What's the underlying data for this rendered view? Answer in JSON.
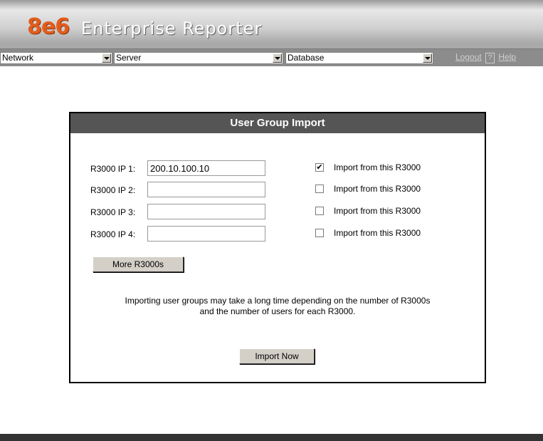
{
  "logo": {
    "number": "8e6",
    "product": "Enterprise Reporter"
  },
  "nav": {
    "network": "Network",
    "server": "Server",
    "database": "Database",
    "logout": "Logout",
    "help_icon": "?",
    "help": "Help"
  },
  "panel": {
    "title": "User Group Import",
    "rows": [
      {
        "label": "R3000 IP 1:",
        "value": "200.10.100.10",
        "checked": true,
        "check_label": "Import from this R3000"
      },
      {
        "label": "R3000 IP 2:",
        "value": "",
        "checked": false,
        "check_label": "Import from this R3000"
      },
      {
        "label": "R3000 IP 3:",
        "value": "",
        "checked": false,
        "check_label": "Import from this R3000"
      },
      {
        "label": "R3000 IP 4:",
        "value": "",
        "checked": false,
        "check_label": "Import from this R3000"
      }
    ],
    "more_button": "More R3000s",
    "info_line1": "Importing user groups may take a long time depending on the number of R3000s",
    "info_line2": "and the number of users for each R3000.",
    "import_button": "Import Now"
  },
  "colors": {
    "logo_orange": "#e25c1c",
    "panel_header": "#555555"
  }
}
